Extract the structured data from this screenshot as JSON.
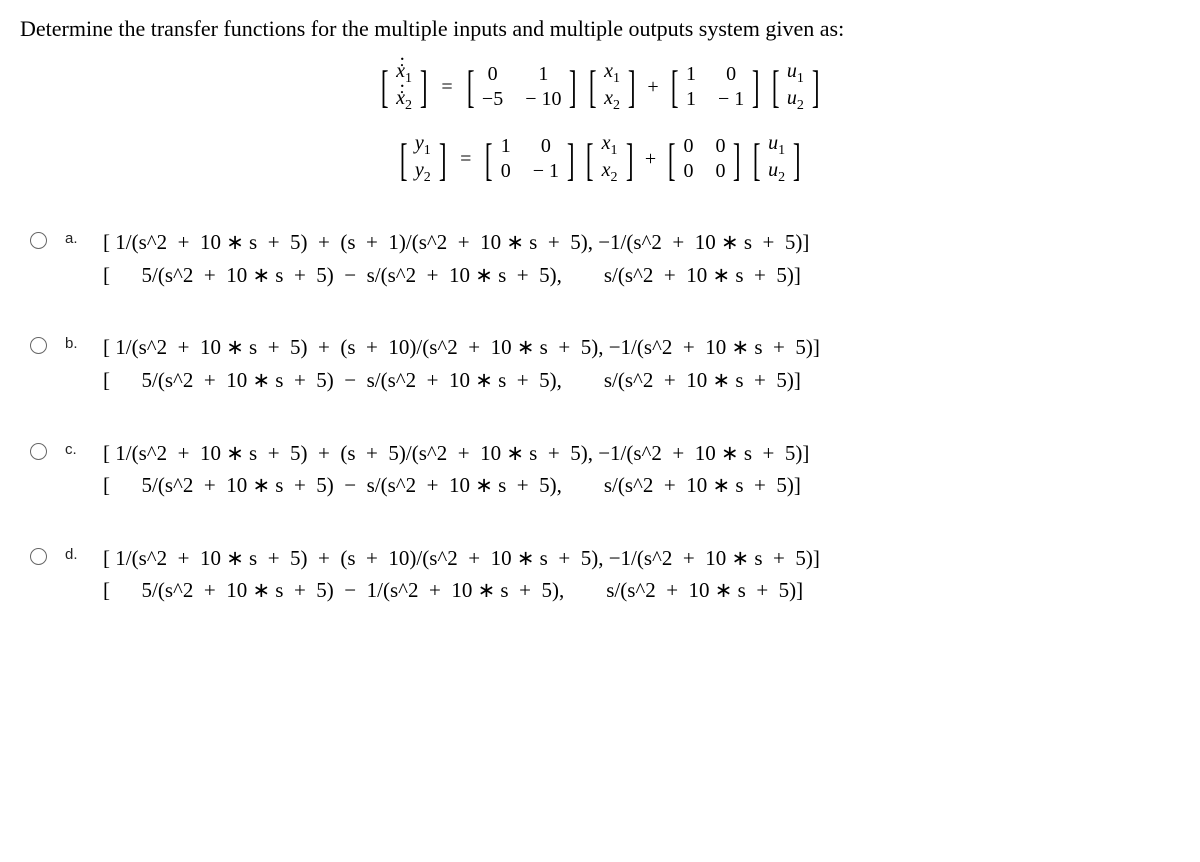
{
  "question": "Determine the transfer functions for the multiple inputs and multiple outputs system given as:",
  "eq1": {
    "lhs_top": "ẋ",
    "lhs_top_sub": "1",
    "lhs_bot": "ẋ",
    "lhs_bot_sub": "2",
    "A": [
      "0",
      "1",
      "−5",
      "− 10"
    ],
    "x_top": "x",
    "x_top_sub": "1",
    "x_bot": "x",
    "x_bot_sub": "2",
    "B": [
      "1",
      "0",
      "1",
      "− 1"
    ],
    "u_top": "u",
    "u_top_sub": "1",
    "u_bot": "u",
    "u_bot_sub": "2"
  },
  "eq2": {
    "lhs_top": "y",
    "lhs_top_sub": "1",
    "lhs_bot": "y",
    "lhs_bot_sub": "2",
    "C": [
      "1",
      "0",
      "0",
      "− 1"
    ],
    "x_top": "x",
    "x_top_sub": "1",
    "x_bot": "x",
    "x_bot_sub": "2",
    "D": [
      "0",
      "0",
      "0",
      "0"
    ],
    "u_top": "u",
    "u_top_sub": "1",
    "u_bot": "u",
    "u_bot_sub": "2"
  },
  "options": [
    {
      "label": "a.",
      "line1": "[ 1/(s^2  +  10 ∗ s  +  5)  +  (s  +  1)/(s^2  +  10 ∗ s  +  5), −1/(s^2  +  10 ∗ s  +  5)]",
      "line2": "[      5/(s^2  +  10 ∗ s  +  5)  −  s/(s^2  +  10 ∗ s  +  5),        s/(s^2  +  10 ∗ s  +  5)]"
    },
    {
      "label": "b.",
      "line1": "[ 1/(s^2  +  10 ∗ s  +  5)  +  (s  +  10)/(s^2  +  10 ∗ s  +  5), −1/(s^2  +  10 ∗ s  +  5)]",
      "line2": "[      5/(s^2  +  10 ∗ s  +  5)  −  s/(s^2  +  10 ∗ s  +  5),        s/(s^2  +  10 ∗ s  +  5)]"
    },
    {
      "label": "c.",
      "line1": "[ 1/(s^2  +  10 ∗ s  +  5)  +  (s  +  5)/(s^2  +  10 ∗ s  +  5), −1/(s^2  +  10 ∗ s  +  5)]",
      "line2": "[      5/(s^2  +  10 ∗ s  +  5)  −  s/(s^2  +  10 ∗ s  +  5),        s/(s^2  +  10 ∗ s  +  5)]"
    },
    {
      "label": "d.",
      "line1": "[ 1/(s^2  +  10 ∗ s  +  5)  +  (s  +  10)/(s^2  +  10 ∗ s  +  5), −1/(s^2  +  10 ∗ s  +  5)]",
      "line2": "[      5/(s^2  +  10 ∗ s  +  5)  −  1/(s^2  +  10 ∗ s  +  5),        s/(s^2  +  10 ∗ s  +  5)]"
    }
  ]
}
